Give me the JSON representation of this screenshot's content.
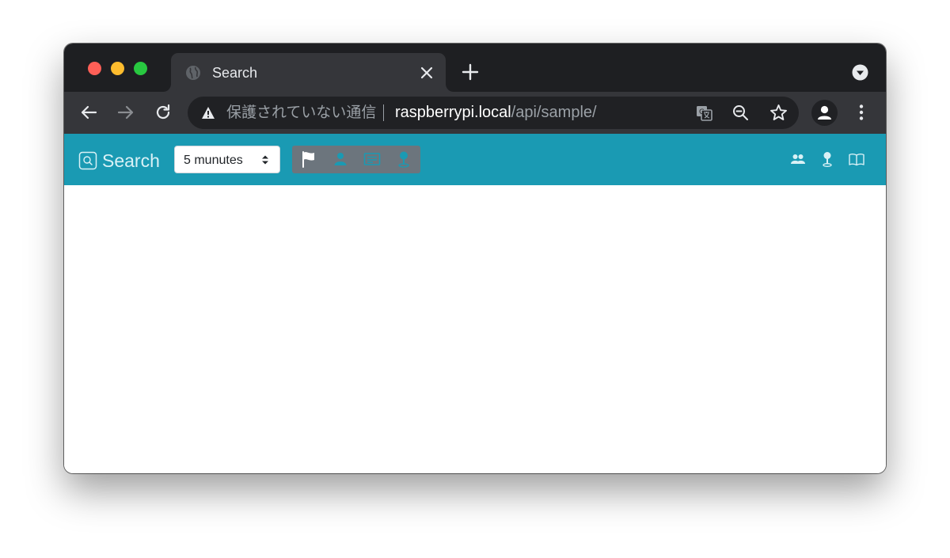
{
  "browser": {
    "tab": {
      "title": "Search",
      "favicon": "globe-icon"
    },
    "address_bar": {
      "security_label": "保護されていない通信",
      "url_host": "raspberrypi.local",
      "url_path": "/api/sample/"
    }
  },
  "app": {
    "brand": {
      "label": "Search",
      "icon": "search-icon"
    },
    "interval_select": {
      "value": "5 munutes"
    },
    "toolbar_buttons": [
      {
        "icon": "flag-icon",
        "active": true
      },
      {
        "icon": "person-icon",
        "active": false
      },
      {
        "icon": "message-icon",
        "active": false
      },
      {
        "icon": "map-pin-icon",
        "active": false
      }
    ],
    "right_buttons": [
      {
        "icon": "users-icon"
      },
      {
        "icon": "map-pin-icon"
      },
      {
        "icon": "book-icon"
      }
    ]
  },
  "colors": {
    "app_bar": "#1a9ab3",
    "button_group": "#6c757d",
    "chrome_titlebar": "#1e1f22",
    "chrome_toolbar": "#35363a"
  }
}
